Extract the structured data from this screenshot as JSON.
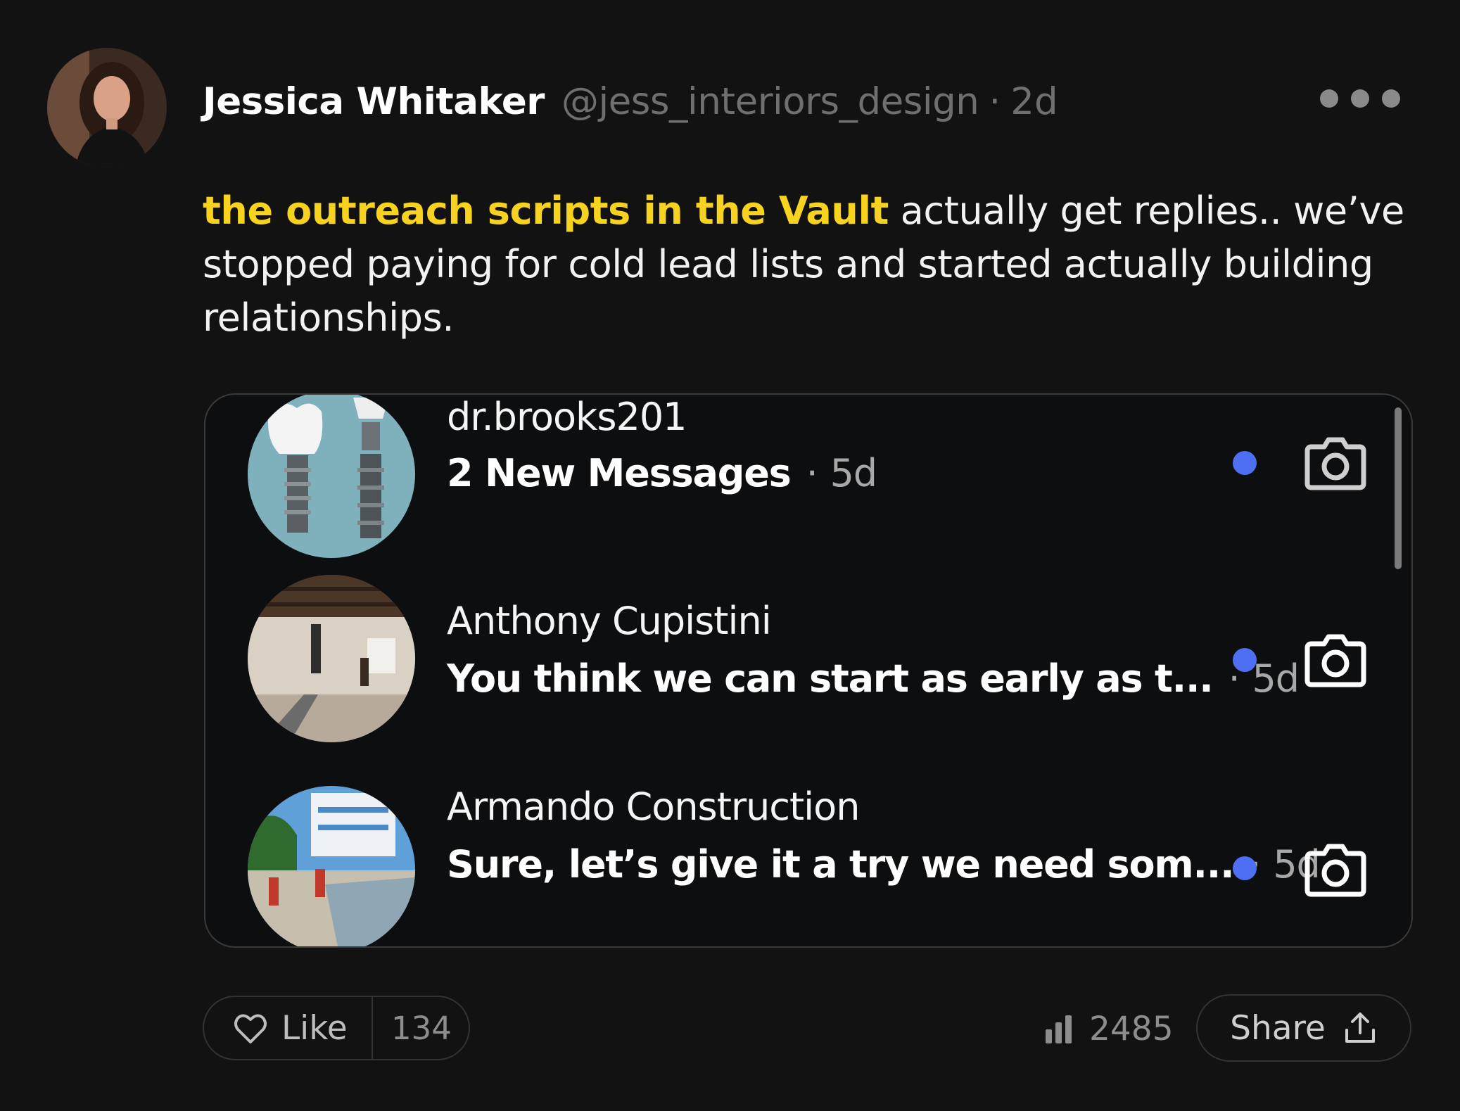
{
  "post": {
    "author_name": "Jessica Whitaker",
    "author_handle": "@jess_interiors_design",
    "separator": "·",
    "age": "2d",
    "text_highlight": "the outreach scripts in the Vault",
    "text_rest": " actually get replies.. we’ve stopped paying for cold lead lists and started actually building relationships."
  },
  "attachment": {
    "conversations": [
      {
        "name": "dr.brooks201",
        "preview": "2 New Messages",
        "separator": "·",
        "time": "5d",
        "unread": true,
        "avatar_icon": "dental-implant-image"
      },
      {
        "name": "Anthony Cupistini",
        "preview": "You think we can start as early as t...",
        "separator": "·",
        "time": "5d",
        "unread": true,
        "avatar_icon": "renovation-room-image"
      },
      {
        "name": "Armando Construction",
        "preview": "Sure, let’s give it a try we need som...",
        "separator": "·",
        "time": "5d",
        "unread": true,
        "avatar_icon": "construction-site-image"
      }
    ],
    "unread_color": "#4f6ff2"
  },
  "actions": {
    "like_label": "Like",
    "like_count": "134",
    "views_count": "2485",
    "share_label": "Share"
  },
  "colors": {
    "background": "#121212",
    "highlight": "#f7d21e",
    "muted": "#6f6f6f"
  }
}
